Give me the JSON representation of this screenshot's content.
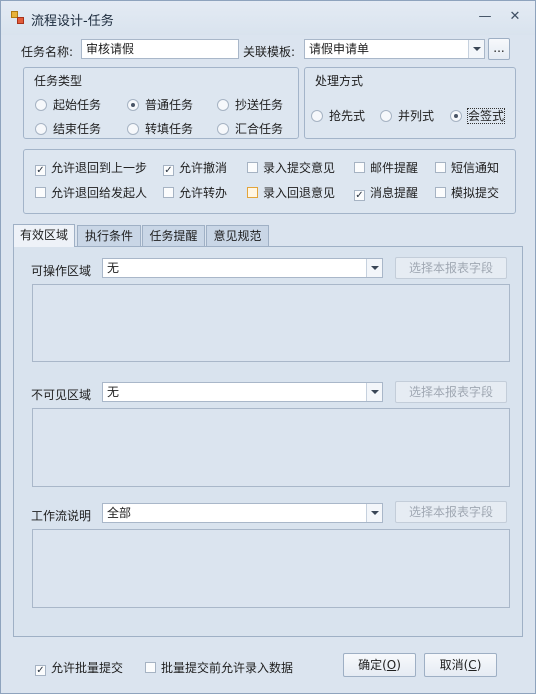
{
  "window": {
    "title": "流程设计-任务",
    "minimize": "—",
    "close": "✕"
  },
  "header": {
    "task_name_label": "任务名称:",
    "task_name_value": "审核请假",
    "template_label": "关联模板:",
    "template_value": "请假申请单",
    "browse_label": "..."
  },
  "task_type": {
    "title": "任务类型",
    "options": [
      "起始任务",
      "普通任务",
      "抄送任务",
      "结束任务",
      "转填任务",
      "汇合任务"
    ],
    "selected": "普通任务"
  },
  "process_mode": {
    "title": "处理方式",
    "options": [
      "抢先式",
      "并列式",
      "会签式"
    ],
    "selected": "会签式"
  },
  "options": {
    "items": [
      {
        "label": "允许退回到上一步",
        "checked": true
      },
      {
        "label": "允许撤消",
        "checked": true
      },
      {
        "label": "录入提交意见",
        "checked": false
      },
      {
        "label": "邮件提醒",
        "checked": false
      },
      {
        "label": "短信通知",
        "checked": false
      },
      {
        "label": "允许退回给发起人",
        "checked": false
      },
      {
        "label": "允许转办",
        "checked": false
      },
      {
        "label": "录入回退意见",
        "checked": false,
        "highlight": true
      },
      {
        "label": "消息提醒",
        "checked": true
      },
      {
        "label": "模拟提交",
        "checked": false
      }
    ]
  },
  "tabs": [
    "有效区域",
    "执行条件",
    "任务提醒",
    "意见规范"
  ],
  "active_tab": "有效区域",
  "panel": {
    "editable_label": "可操作区域",
    "editable_value": "无",
    "invisible_label": "不可见区域",
    "invisible_value": "无",
    "workflow_label": "工作流说明",
    "workflow_value": "全部",
    "select_field_button": "选择本报表字段"
  },
  "footer": {
    "batch_submit": {
      "label": "允许批量提交",
      "checked": true
    },
    "batch_input": {
      "label": "批量提交前允许录入数据",
      "checked": false
    },
    "ok_text": "确定(",
    "ok_key": "O",
    "ok_end": ")",
    "cancel_text": "取消(",
    "cancel_key": "C",
    "cancel_end": ")"
  },
  "colors": {
    "accent": "#dbe4ef",
    "highlight_border": "#e3a43a"
  }
}
